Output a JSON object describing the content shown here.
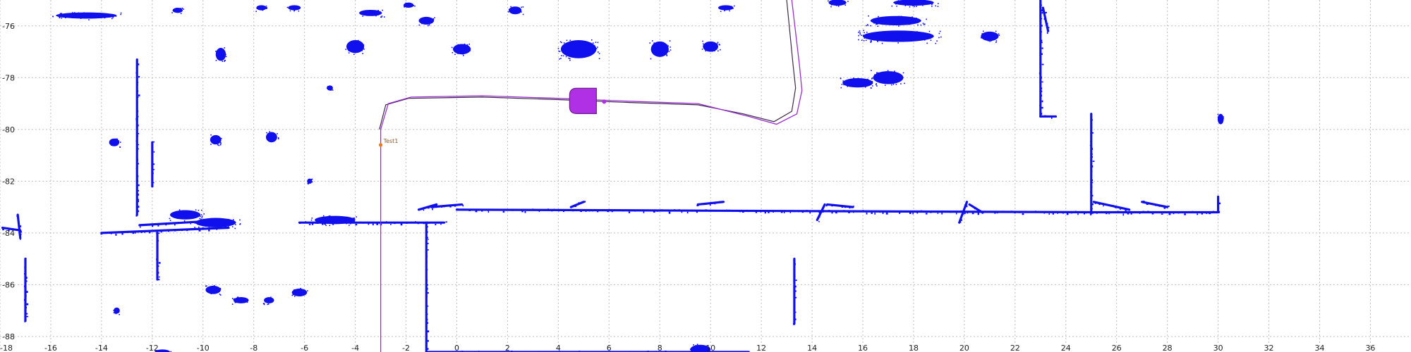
{
  "view": {
    "type": "occupancy-map",
    "x_range": [
      -18,
      37.6
    ],
    "y_range": [
      -75,
      -88.6
    ],
    "x_ticks": [
      -18,
      -16,
      -14,
      -12,
      -10,
      -8,
      -6,
      -4,
      -2,
      0,
      2,
      4,
      6,
      8,
      10,
      12,
      14,
      16,
      18,
      20,
      22,
      24,
      26,
      28,
      30,
      32,
      34,
      36
    ],
    "y_ticks": [
      -76,
      -78,
      -80,
      -82,
      -84,
      -86,
      -88
    ],
    "grid": true,
    "colors": {
      "obstacles": "#1010ee",
      "path_primary": "#9a2fd1",
      "path_secondary": "#3b2a45",
      "robot": "#b030e6",
      "marker": "#f07a1a"
    }
  },
  "marker": {
    "label": "Test1",
    "x": -3.0,
    "y": -80.6
  },
  "robot": {
    "x": 5.0,
    "y": -78.9
  },
  "path_primary": [
    [
      -3.0,
      -89.0
    ],
    [
      -3.0,
      -80.0
    ],
    [
      -2.7,
      -79.0
    ],
    [
      -1.8,
      -78.75
    ],
    [
      1.0,
      -78.7
    ],
    [
      4.0,
      -78.8
    ],
    [
      6.5,
      -78.9
    ],
    [
      9.5,
      -79.0
    ],
    [
      11.5,
      -79.5
    ],
    [
      12.6,
      -79.8
    ],
    [
      13.4,
      -79.4
    ],
    [
      13.6,
      -78.5
    ],
    [
      13.5,
      -77.5
    ],
    [
      13.2,
      -75.0
    ]
  ],
  "path_secondary": [
    [
      -3.05,
      -80.0
    ],
    [
      -2.8,
      -79.05
    ],
    [
      -1.9,
      -78.8
    ],
    [
      1.0,
      -78.75
    ],
    [
      4.0,
      -78.85
    ],
    [
      6.5,
      -78.95
    ],
    [
      9.5,
      -79.05
    ],
    [
      11.3,
      -79.4
    ],
    [
      12.5,
      -79.7
    ],
    [
      13.2,
      -79.3
    ],
    [
      13.35,
      -78.4
    ],
    [
      13.25,
      -77.5
    ],
    [
      13.0,
      -75.0
    ]
  ],
  "walls": [
    [
      [
        -15.5,
        -75.6
      ],
      [
        -13.8,
        -75.6
      ]
    ],
    [
      [
        -12.6,
        -77.3
      ],
      [
        -12.6,
        -79.6
      ]
    ],
    [
      [
        -12.6,
        -79.6
      ],
      [
        -12.6,
        -83.3
      ]
    ],
    [
      [
        -12.0,
        -80.5
      ],
      [
        -12.0,
        -82.2
      ]
    ],
    [
      [
        -14.0,
        -84.0
      ],
      [
        -9.0,
        -83.8
      ]
    ],
    [
      [
        -12.5,
        -83.7
      ],
      [
        -9.0,
        -83.5
      ]
    ],
    [
      [
        -11.8,
        -84.0
      ],
      [
        -11.8,
        -85.8
      ]
    ],
    [
      [
        -6.2,
        -83.6
      ],
      [
        -0.5,
        -83.6
      ]
    ],
    [
      [
        -1.5,
        -83.1
      ],
      [
        -0.8,
        -82.9
      ]
    ],
    [
      [
        -1.0,
        -83.0
      ],
      [
        0.2,
        -82.9
      ]
    ],
    [
      [
        -1.2,
        -83.6
      ],
      [
        -1.2,
        -88.6
      ]
    ],
    [
      [
        -1.2,
        -88.6
      ],
      [
        11.5,
        -88.6
      ]
    ],
    [
      [
        0.0,
        -83.1
      ],
      [
        25.0,
        -83.2
      ]
    ],
    [
      [
        4.5,
        -83.0
      ],
      [
        5.0,
        -82.8
      ]
    ],
    [
      [
        9.5,
        -82.9
      ],
      [
        10.5,
        -82.8
      ]
    ],
    [
      [
        14.2,
        -83.5
      ],
      [
        14.5,
        -82.9
      ]
    ],
    [
      [
        14.6,
        -82.9
      ],
      [
        15.6,
        -83.0
      ]
    ],
    [
      [
        19.8,
        -83.6
      ],
      [
        20.1,
        -82.8
      ]
    ],
    [
      [
        20.2,
        -82.9
      ],
      [
        20.7,
        -83.2
      ]
    ],
    [
      [
        25.0,
        -83.2
      ],
      [
        30.0,
        -83.2
      ]
    ],
    [
      [
        25.0,
        -79.4
      ],
      [
        25.0,
        -83.2
      ]
    ],
    [
      [
        25.1,
        -82.8
      ],
      [
        26.5,
        -83.1
      ]
    ],
    [
      [
        27.0,
        -82.8
      ],
      [
        28.0,
        -83.0
      ]
    ],
    [
      [
        30.0,
        -82.6
      ],
      [
        30.0,
        -83.2
      ]
    ],
    [
      [
        23.0,
        -75.0
      ],
      [
        23.0,
        -79.5
      ]
    ],
    [
      [
        23.0,
        -79.5
      ],
      [
        23.6,
        -79.5
      ]
    ],
    [
      [
        23.1,
        -75.3
      ],
      [
        23.3,
        -76.2
      ]
    ],
    [
      [
        13.3,
        -85.0
      ],
      [
        13.3,
        -87.5
      ]
    ],
    [
      [
        -17.9,
        -83.8
      ],
      [
        -17.2,
        -83.9
      ]
    ],
    [
      [
        -17.3,
        -83.3
      ],
      [
        -17.2,
        -84.2
      ]
    ],
    [
      [
        -17.0,
        -85.0
      ],
      [
        -17.0,
        -87.4
      ]
    ]
  ],
  "blobs": [
    [
      -14.6,
      -75.6,
      1.2,
      0.12
    ],
    [
      -4.0,
      -76.8,
      0.35,
      0.25
    ],
    [
      -1.2,
      -75.8,
      0.3,
      0.15
    ],
    [
      -3.4,
      -75.5,
      0.45,
      0.12
    ],
    [
      0.2,
      -76.9,
      0.35,
      0.2
    ],
    [
      4.8,
      -76.9,
      0.7,
      0.35
    ],
    [
      8.0,
      -76.9,
      0.35,
      0.3
    ],
    [
      10.0,
      -76.8,
      0.3,
      0.2
    ],
    [
      17.3,
      -75.8,
      1.0,
      0.18
    ],
    [
      17.4,
      -76.4,
      1.4,
      0.22
    ],
    [
      21.0,
      -76.4,
      0.35,
      0.18
    ],
    [
      18.0,
      -75.1,
      0.8,
      0.12
    ],
    [
      15.0,
      -75.1,
      0.35,
      0.12
    ],
    [
      17.0,
      -78.0,
      0.6,
      0.25
    ],
    [
      15.8,
      -78.2,
      0.6,
      0.18
    ],
    [
      -13.5,
      -80.5,
      0.2,
      0.15
    ],
    [
      -9.5,
      -80.4,
      0.22,
      0.18
    ],
    [
      -7.3,
      -80.3,
      0.22,
      0.2
    ],
    [
      -10.7,
      -83.3,
      0.6,
      0.18
    ],
    [
      -9.5,
      -83.6,
      0.8,
      0.18
    ],
    [
      -4.8,
      -83.5,
      0.8,
      0.16
    ],
    [
      -6.2,
      -86.3,
      0.3,
      0.15
    ],
    [
      -9.6,
      -86.2,
      0.3,
      0.16
    ],
    [
      -8.5,
      -86.6,
      0.3,
      0.12
    ],
    [
      -7.4,
      -86.6,
      0.2,
      0.12
    ],
    [
      -13.4,
      -87.0,
      0.12,
      0.12
    ],
    [
      -11.6,
      -88.6,
      0.3,
      0.1
    ],
    [
      -9.3,
      -77.1,
      0.2,
      0.25
    ],
    [
      -5.0,
      -78.4,
      0.12,
      0.1
    ],
    [
      -5.8,
      -82.0,
      0.1,
      0.1
    ],
    [
      -11.0,
      -75.4,
      0.2,
      0.1
    ],
    [
      -6.4,
      -75.3,
      0.25,
      0.1
    ],
    [
      -7.7,
      -75.3,
      0.2,
      0.1
    ],
    [
      -1.9,
      -75.2,
      0.2,
      0.1
    ],
    [
      2.3,
      -75.4,
      0.25,
      0.15
    ],
    [
      10.6,
      -75.3,
      0.3,
      0.1
    ],
    [
      30.1,
      -79.6,
      0.12,
      0.2
    ],
    [
      9.6,
      -88.5,
      0.4,
      0.18
    ]
  ]
}
